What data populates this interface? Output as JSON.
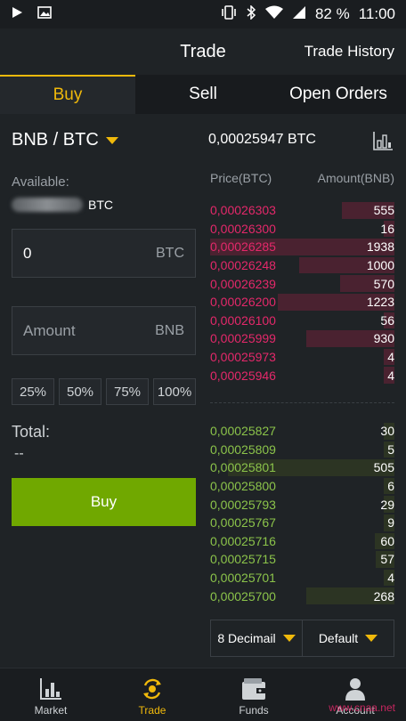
{
  "statusbar": {
    "battery": "82 %",
    "time": "11:00"
  },
  "header": {
    "title": "Trade",
    "history": "Trade History"
  },
  "tabs": [
    {
      "label": "Buy"
    },
    {
      "label": "Sell"
    },
    {
      "label": "Open Orders"
    }
  ],
  "pair": "BNB / BTC",
  "available": {
    "label": "Available:",
    "currency": "BTC"
  },
  "price_input": {
    "value": "0",
    "unit": "BTC"
  },
  "amount_input": {
    "placeholder": "Amount",
    "unit": "BNB"
  },
  "percents": [
    "25%",
    "50%",
    "75%",
    "100%"
  ],
  "total": {
    "label": "Total:",
    "value": "--"
  },
  "buy_button": "Buy",
  "last_price": "0,00025947 BTC",
  "orderbook": {
    "price_header": "Price(BTC)",
    "amount_header": "Amount(BNB)",
    "asks": [
      {
        "price": "0,00026303",
        "amount": "555"
      },
      {
        "price": "0,00026300",
        "amount": "16"
      },
      {
        "price": "0,00026285",
        "amount": "1938"
      },
      {
        "price": "0,00026248",
        "amount": "1000"
      },
      {
        "price": "0,00026239",
        "amount": "570"
      },
      {
        "price": "0,00026200",
        "amount": "1223"
      },
      {
        "price": "0,00026100",
        "amount": "56"
      },
      {
        "price": "0,00025999",
        "amount": "930"
      },
      {
        "price": "0,00025973",
        "amount": "4"
      },
      {
        "price": "0,00025946",
        "amount": "4"
      }
    ],
    "bids": [
      {
        "price": "0,00025827",
        "amount": "30"
      },
      {
        "price": "0,00025809",
        "amount": "5"
      },
      {
        "price": "0,00025801",
        "amount": "505"
      },
      {
        "price": "0,00025800",
        "amount": "6"
      },
      {
        "price": "0,00025793",
        "amount": "29"
      },
      {
        "price": "0,00025767",
        "amount": "9"
      },
      {
        "price": "0,00025716",
        "amount": "60"
      },
      {
        "price": "0,00025715",
        "amount": "57"
      },
      {
        "price": "0,00025701",
        "amount": "4"
      },
      {
        "price": "0,00025700",
        "amount": "268"
      }
    ]
  },
  "selects": {
    "decimal": "8 Decimail",
    "mode": "Default"
  },
  "nav": [
    {
      "label": "Market"
    },
    {
      "label": "Trade"
    },
    {
      "label": "Funds"
    },
    {
      "label": "Account"
    }
  ],
  "watermark": "www.cnaa.net",
  "colors": {
    "accent": "#f0b90b",
    "buy": "#70a800",
    "ask": "#e4286a",
    "bid": "#8bc34a"
  }
}
